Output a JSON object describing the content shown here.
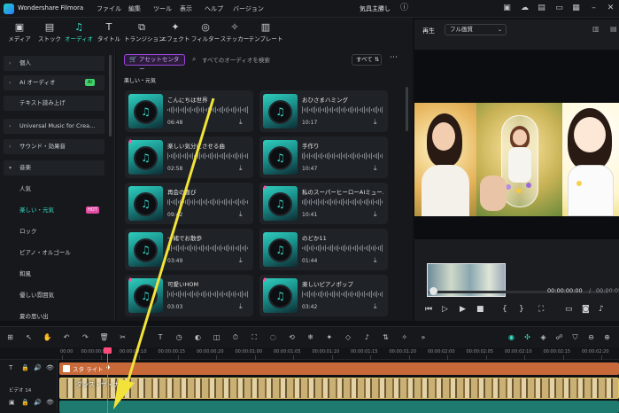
{
  "app": {
    "name": "Wondershare Filmora",
    "project_name": "気具主勝し"
  },
  "menu": [
    "ファイル",
    "編集",
    "ツール",
    "表示",
    "ヘルプ",
    "バージョン"
  ],
  "titlebar_icons": [
    "gift-icon",
    "cloud-icon",
    "bell-icon",
    "save-icon",
    "layout-icon",
    "minimize-icon",
    "maximize-icon",
    "close-icon"
  ],
  "toolbar": [
    {
      "label": "メディア",
      "icon": "media-icon"
    },
    {
      "label": "ストック",
      "icon": "stock-icon"
    },
    {
      "label": "オーディオ",
      "icon": "music-icon",
      "active": true
    },
    {
      "label": "タイトル",
      "icon": "title-icon"
    },
    {
      "label": "トランジション",
      "icon": "transition-icon"
    },
    {
      "label": "エフェクト",
      "icon": "effect-icon"
    },
    {
      "label": "フィルター",
      "icon": "filter-icon"
    },
    {
      "label": "ステッカー",
      "icon": "sticker-icon"
    },
    {
      "label": "テンプレート",
      "icon": "template-icon"
    }
  ],
  "sidebar": {
    "items": [
      {
        "label": "個人",
        "arrow": "›",
        "box": true
      },
      {
        "label": "AI オーディオ",
        "arrow": "›",
        "box": true,
        "badge": "AI"
      },
      {
        "label": "テキスト読み上げ",
        "arrow": "",
        "box": true
      },
      {
        "label": "Universal Music for Crea...",
        "arrow": "›",
        "box": true
      },
      {
        "label": "サウンド・効果音",
        "arrow": "›",
        "box": true
      },
      {
        "label": "音楽",
        "arrow": "⌄",
        "box": true
      },
      {
        "label": "人気",
        "arrow": "",
        "box": false
      },
      {
        "label": "楽しい・元気",
        "arrow": "",
        "box": false,
        "selected": true,
        "badge_hot": "HOT"
      },
      {
        "label": "ロック",
        "arrow": "",
        "box": false
      },
      {
        "label": "ピアノ・オルゴール",
        "arrow": "",
        "box": false
      },
      {
        "label": "和風",
        "arrow": "",
        "box": false
      },
      {
        "label": "優しい雰囲気",
        "arrow": "",
        "box": false
      },
      {
        "label": "夏の思い出",
        "arrow": "",
        "box": false
      }
    ]
  },
  "content": {
    "asset_center_label": "アセットセンター",
    "search_placeholder": "すべてのオーディオを検索",
    "filter_label": "すべて",
    "category_title": "楽しい・元気",
    "cards": [
      {
        "title": "こんにちは世界",
        "duration": "06:48",
        "premium": false
      },
      {
        "title": "おひさまハミング",
        "duration": "10:17",
        "premium": false
      },
      {
        "title": "楽しい気分にさせる曲",
        "duration": "02:58",
        "premium": true
      },
      {
        "title": "手作り",
        "duration": "10:47",
        "premium": false
      },
      {
        "title": "再会の喜び",
        "duration": "09:42",
        "premium": false
      },
      {
        "title": "私のスーパーヒーローAIミュー...",
        "duration": "10:41",
        "premium": true
      },
      {
        "title": "一緒でお散歩",
        "duration": "03:49",
        "premium": false
      },
      {
        "title": "のどか11",
        "duration": "01:44",
        "premium": false
      },
      {
        "title": "可愛いHOM",
        "duration": "03:03",
        "premium": true
      },
      {
        "title": "楽しいピアノポップ",
        "duration": "03:42",
        "premium": true
      }
    ]
  },
  "preview": {
    "label": "再生",
    "quality": "フル画質",
    "time_current": "00:00:00:00",
    "time_sep": "/",
    "time_total": "00:00:05",
    "progress": 0.02
  },
  "timeline": {
    "ruler": [
      "00:00",
      "00:00:00:05",
      "00:00:00:10",
      "00:00:00:15",
      "00:00:00:20",
      "00:00:01:00",
      "00:00:01:05",
      "00:00:01:10",
      "00:00:01:15",
      "00:00:01:20",
      "00:00:02:00",
      "00:00:02:05",
      "00:00:02:10",
      "00:00:02:15",
      "00:00:02:20",
      "00:00:03:00"
    ],
    "text_track_label": "スタ ライト",
    "video_track_name": "ビデオ 14",
    "video_clip_label": "ダンス・ザ・ナイト"
  },
  "colors": {
    "accent": "#37e0c8",
    "playhead": "#ff4a7a",
    "arrow": "#f2e23a"
  }
}
